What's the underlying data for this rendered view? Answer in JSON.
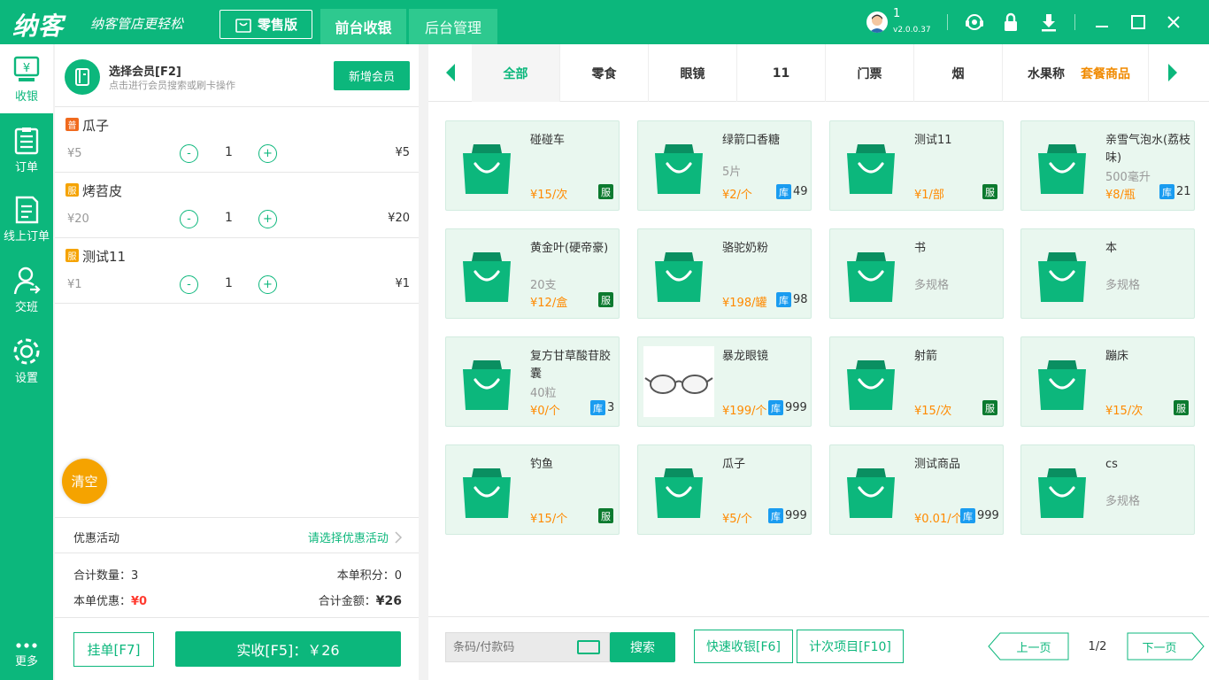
{
  "topbar": {
    "logo": "纳客",
    "slogan": "纳客管店更轻松",
    "edition": "零售版",
    "tabs": [
      "前台收银",
      "后台管理"
    ],
    "user_name": "1",
    "version": "v2.0.0.37"
  },
  "sidebar": {
    "items": [
      {
        "label": "收银",
        "icon": "cashier-icon"
      },
      {
        "label": "订单",
        "icon": "order-icon"
      },
      {
        "label": "线上订单",
        "icon": "online-order-icon"
      },
      {
        "label": "交班",
        "icon": "shift-icon"
      },
      {
        "label": "设置",
        "icon": "settings-icon"
      }
    ],
    "more": "更多"
  },
  "member": {
    "title": "选择会员[F2]",
    "subtitle": "点击进行会员搜索或刷卡操作",
    "add_button": "新增会员"
  },
  "cart": {
    "items": [
      {
        "badge": "普",
        "badge_color": "#f06a1e",
        "name": "瓜子",
        "price": "¥5",
        "minus": "-",
        "qty": "1",
        "plus": "+",
        "total": "¥5"
      },
      {
        "badge": "服",
        "badge_color": "#f5a300",
        "name": "烤苕皮",
        "price": "¥20",
        "minus": "-",
        "qty": "1",
        "plus": "+",
        "total": "¥20"
      },
      {
        "badge": "服",
        "badge_color": "#f5a300",
        "name": "测试11",
        "price": "¥1",
        "minus": "-",
        "qty": "1",
        "plus": "+",
        "total": "¥1"
      }
    ],
    "clear_button": "清空"
  },
  "promotion": {
    "label": "优惠活动",
    "action": "请选择优惠活动"
  },
  "summary": {
    "qty_label": "合计数量：",
    "qty_value": "3",
    "points_label": "本单积分：",
    "points_value": "0",
    "discount_label": "本单优惠：",
    "discount_value": "¥0",
    "total_label": "合计金额：",
    "total_value": "¥26"
  },
  "actions": {
    "hold": "挂单[F7]",
    "pay": "实收[F5]：￥26"
  },
  "categories": [
    "全部",
    "零食",
    "眼镜",
    "11",
    "门票",
    "烟",
    "水果称",
    "套餐商品"
  ],
  "products": [
    {
      "name": "碰碰车",
      "spec": "",
      "price": "¥15/次",
      "tag": "服",
      "tag_type": "srv",
      "stock": ""
    },
    {
      "name": "绿箭口香糖",
      "spec": "5片",
      "price": "¥2/个",
      "tag": "库",
      "tag_type": "stk",
      "stock": "49"
    },
    {
      "name": "测试11",
      "spec": "",
      "price": "¥1/部",
      "tag": "服",
      "tag_type": "srv",
      "stock": ""
    },
    {
      "name": "亲雪气泡水(荔枝味)",
      "spec": "500毫升",
      "price": "¥8/瓶",
      "tag": "库",
      "tag_type": "stk",
      "stock": "21"
    },
    {
      "name": "黄金叶(硬帝豪)",
      "spec": "20支",
      "price": "¥12/盒",
      "tag": "服",
      "tag_type": "srv",
      "stock": ""
    },
    {
      "name": "骆驼奶粉",
      "spec": "",
      "price": "¥198/罐",
      "tag": "库",
      "tag_type": "stk",
      "stock": "98"
    },
    {
      "name": "书",
      "spec": "多规格",
      "price": "",
      "tag": "",
      "tag_type": "",
      "stock": ""
    },
    {
      "name": "本",
      "spec": "多规格",
      "price": "",
      "tag": "",
      "tag_type": "",
      "stock": ""
    },
    {
      "name": "复方甘草酸苷胶囊",
      "spec": "40粒",
      "price": "¥0/个",
      "tag": "库",
      "tag_type": "stk",
      "stock": "3"
    },
    {
      "name": "暴龙眼镜",
      "spec": "",
      "price": "¥199/个",
      "tag": "库",
      "tag_type": "stk",
      "stock": "999"
    },
    {
      "name": "射箭",
      "spec": "",
      "price": "¥15/次",
      "tag": "服",
      "tag_type": "srv",
      "stock": ""
    },
    {
      "name": "蹦床",
      "spec": "",
      "price": "¥15/次",
      "tag": "服",
      "tag_type": "srv",
      "stock": ""
    },
    {
      "name": "钓鱼",
      "spec": "",
      "price": "¥15/个",
      "tag": "服",
      "tag_type": "srv",
      "stock": ""
    },
    {
      "name": "瓜子",
      "spec": "",
      "price": "¥5/个",
      "tag": "库",
      "tag_type": "stk",
      "stock": "999"
    },
    {
      "name": "测试商品",
      "spec": "",
      "price": "¥0.01/个",
      "tag": "库",
      "tag_type": "stk",
      "stock": "999"
    },
    {
      "name": "cs",
      "spec": "多规格",
      "price": "",
      "tag": "",
      "tag_type": "",
      "stock": ""
    }
  ],
  "bottom": {
    "search_placeholder": "条码/付款码",
    "search_button": "搜索",
    "quick_cash": "快速收银[F6]",
    "count_items": "计次项目[F10]",
    "prev_page": "上一页",
    "page_indicator": "1/2",
    "next_page": "下一页"
  },
  "colors": {
    "brand": "#0cb77c",
    "price": "#ff8a00",
    "clear": "#f5a300",
    "discount": "#ff3b30"
  }
}
